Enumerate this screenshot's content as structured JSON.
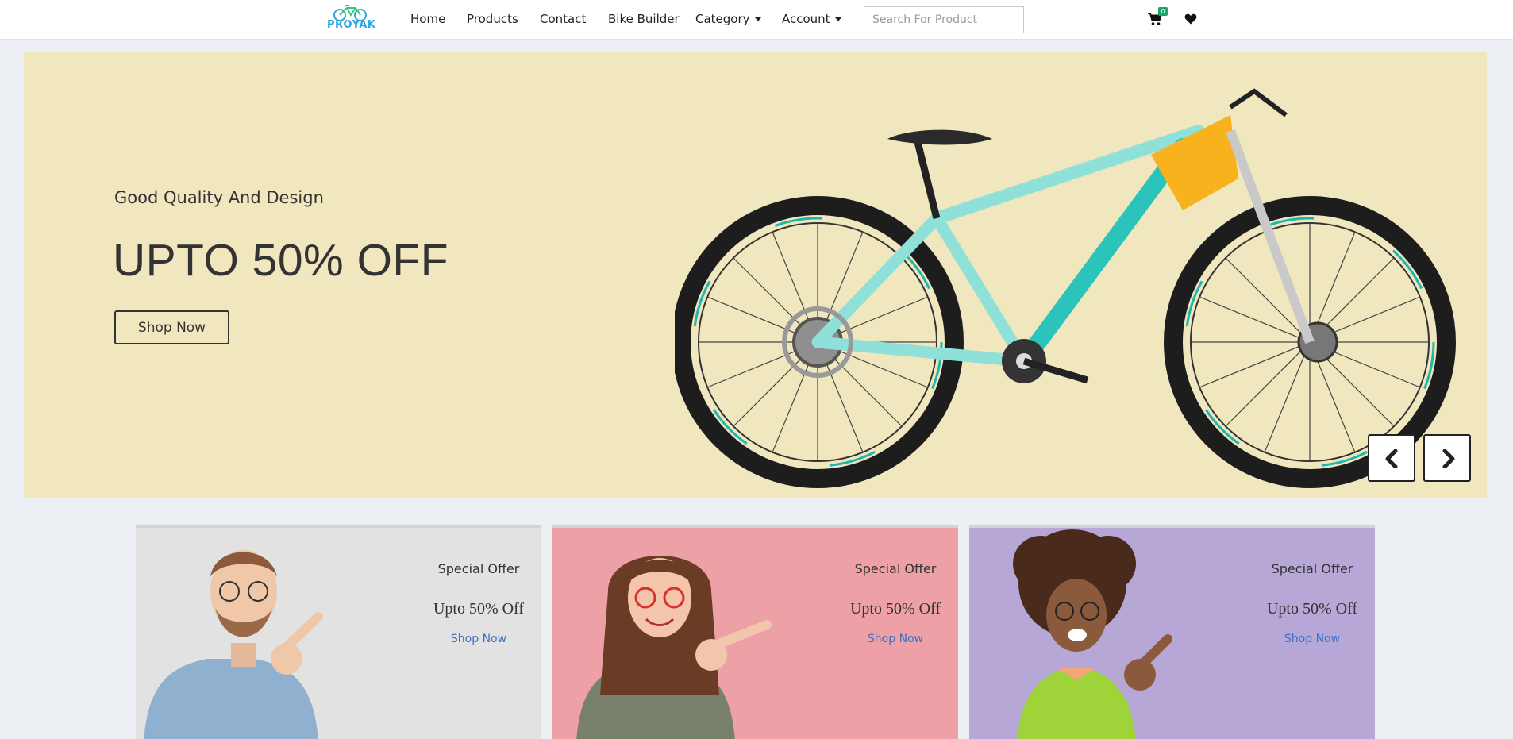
{
  "brand": {
    "logo_text": "PROYAK",
    "logo_color": "#2aa7e0"
  },
  "nav": {
    "links": [
      {
        "label": "Home"
      },
      {
        "label": "Products"
      },
      {
        "label": "Contact"
      },
      {
        "label": "Bike Builder"
      },
      {
        "label": "Category"
      },
      {
        "label": "Account"
      }
    ],
    "search": {
      "placeholder": "Search For Product",
      "value": ""
    },
    "cart_count": "0",
    "icons": [
      "shopping-cart-icon",
      "heart-icon",
      "caret-down-icon"
    ]
  },
  "hero": {
    "subtitle": "Good Quality And Design",
    "title": "UPTO 50% OFF",
    "button": "Shop Now",
    "background": "#f0e7bf",
    "prev_icon": "chevron-left-icon",
    "next_icon": "chevron-right-icon"
  },
  "offers": [
    {
      "label": "Special Offer",
      "discount": "Upto 50% Off",
      "link": "Shop Now",
      "background": "#e2e2e2"
    },
    {
      "label": "Special Offer",
      "discount": "Upto 50% Off",
      "link": "Shop Now",
      "background": "#eda0a5"
    },
    {
      "label": "Special Offer",
      "discount": "Upto 50% Off",
      "link": "Shop Now",
      "background": "#b6a7d6"
    }
  ]
}
